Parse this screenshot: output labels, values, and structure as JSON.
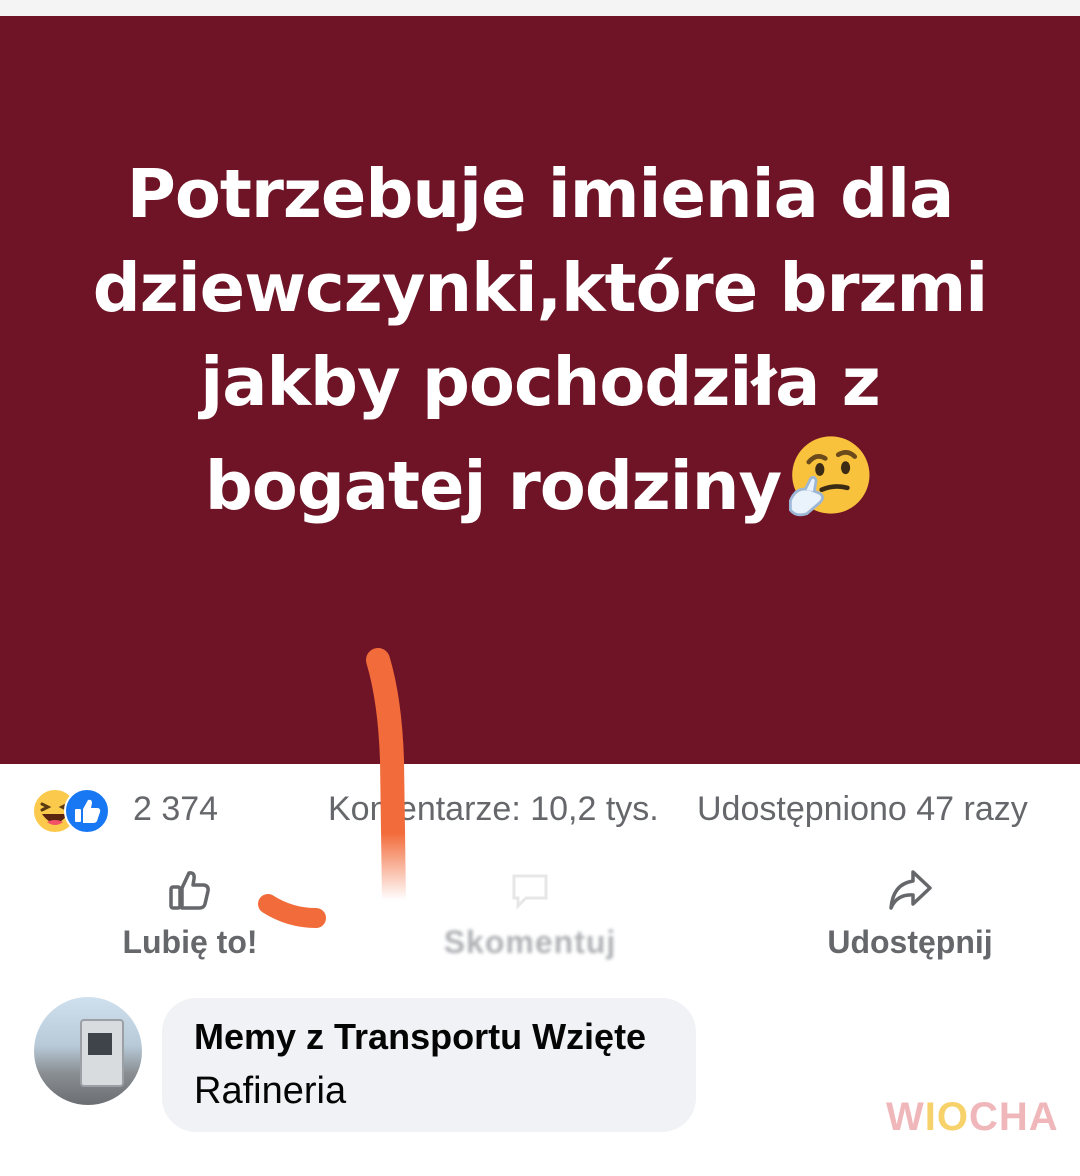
{
  "post": {
    "text": "Potrzebuje imienia dla dziewczynki,które brzmi jakby pochodziła z bogatej rodziny",
    "background_color": "#6e1426",
    "emoji": "thinking-face"
  },
  "stats": {
    "reactions": [
      "haha",
      "like"
    ],
    "reaction_count": "2 374",
    "comments": "Komentarze: 10,2 tys.",
    "shares": "Udostępniono 47 razy"
  },
  "actions": {
    "like": "Lubię to!",
    "comment": "Skomentuj",
    "share": "Udostępnij"
  },
  "comment": {
    "author": "Memy z Transportu Wzięte",
    "text": "Rafineria"
  },
  "watermark": "WIOCHA",
  "annotation_color": "#f26b3a"
}
